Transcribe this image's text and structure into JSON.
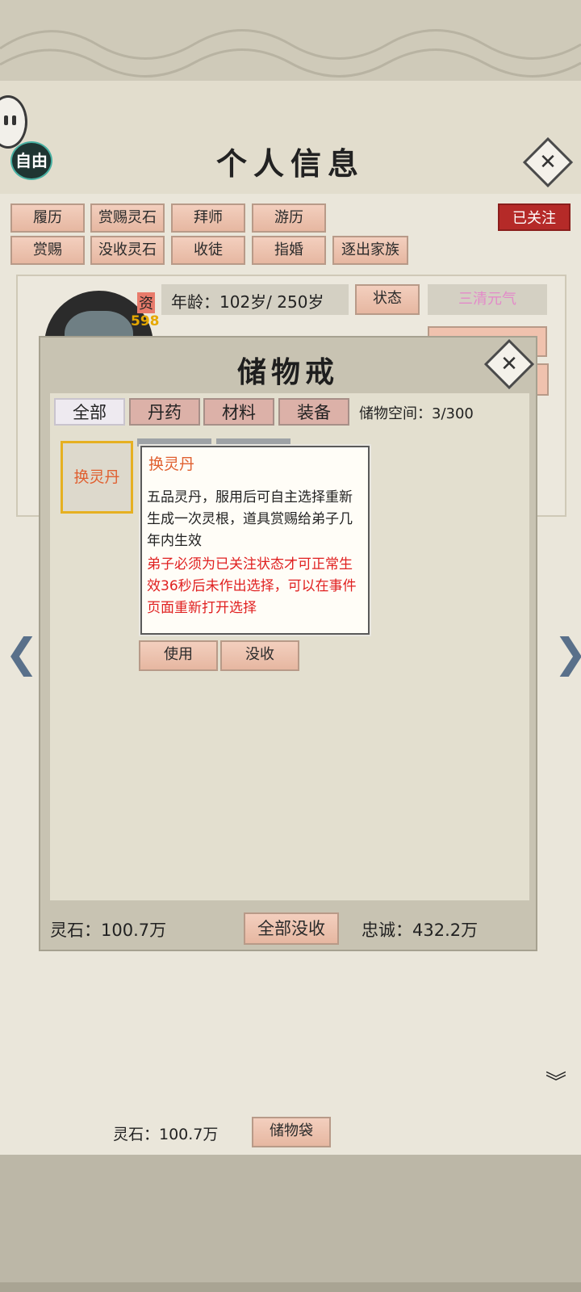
{
  "header": {
    "title": "个人信息",
    "free_label": "自由",
    "close_glyph": "✕"
  },
  "actions": {
    "row1": [
      "履历",
      "赏赐灵石",
      "拜师",
      "游历"
    ],
    "row2": [
      "赏赐",
      "没收灵石",
      "收徒",
      "指婚",
      "逐出家族"
    ],
    "followed_badge": "已关注"
  },
  "profile": {
    "aptitude_label": "资",
    "aptitude_value": "598",
    "age_label": "年龄：",
    "age_value": "102岁/ 250岁",
    "status_button": "状态",
    "qi_badge": "三清元气"
  },
  "navigation": {
    "prev_glyph": "❮",
    "next_glyph": "❯",
    "expand_glyph": "︾"
  },
  "footer": {
    "spirit_stone": "灵石：100.7万",
    "storage_bag_button": "储物袋"
  },
  "storage_modal": {
    "title": "储物戒",
    "close_glyph": "✕",
    "tabs": [
      "全部",
      "丹药",
      "材料",
      "装备"
    ],
    "active_tab": "全部",
    "space_label": "储物空间：3/300",
    "items": [
      {
        "name": "换灵丹"
      }
    ],
    "tooltip": {
      "title": "换灵丹",
      "description": "五品灵丹，服用后可自主选择重新生成一次灵根，道具赏赐给弟子几年内生效",
      "warning": "弟子必须为已关注状态才可正常生效36秒后未作出选择，可以在事件页面重新打开选择"
    },
    "use_button": "使用",
    "confiscate_button": "没收",
    "spirit_stone": "灵石：100.7万",
    "confiscate_all_button": "全部没收",
    "loyalty": "忠诚：432.2万"
  },
  "colors": {
    "accent_button": "#e6b7a1",
    "followed_red": "#b52a28",
    "item_orange": "#e06030",
    "warning_red": "#e02020",
    "qi_pink": "#e38ac9"
  }
}
